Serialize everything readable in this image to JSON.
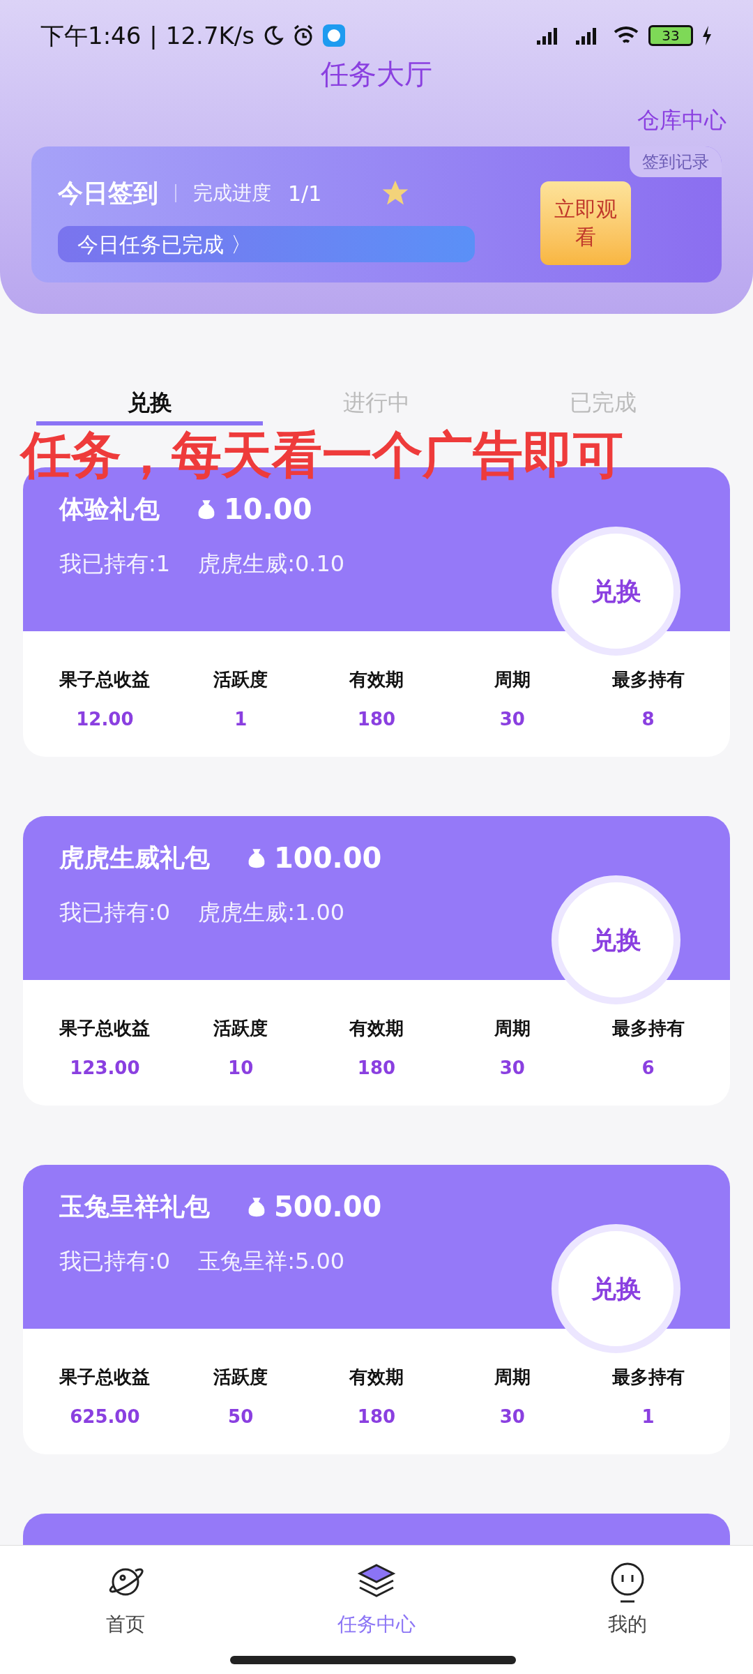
{
  "status_bar": {
    "time": "下午1:46",
    "separator": "|",
    "speed": "12.7K/s",
    "battery": "33"
  },
  "header": {
    "title": "任务大厅",
    "link": "仓库中心"
  },
  "checkin": {
    "title": "今日签到",
    "progress_label": "完成进度",
    "progress": "1/1",
    "status": "今日任务已完成",
    "status_arrow": "〉",
    "record": "签到记录",
    "sticker": "立即观看"
  },
  "tabs": [
    {
      "label": "兑换",
      "selected": true
    },
    {
      "label": "进行中",
      "selected": false
    },
    {
      "label": "已完成",
      "selected": false
    }
  ],
  "packs": [
    {
      "name": "体验礼包",
      "price": "10.00",
      "owned": "我已持有:1",
      "reward": "虎虎生威:0.10",
      "button": "兑换",
      "stats": [
        {
          "label": "果子总收益",
          "value": "12.00"
        },
        {
          "label": "活跃度",
          "value": "1"
        },
        {
          "label": "有效期",
          "value": "180"
        },
        {
          "label": "周期",
          "value": "30"
        },
        {
          "label": "最多持有",
          "value": "8"
        }
      ]
    },
    {
      "name": "虎虎生威礼包",
      "price": "100.00",
      "owned": "我已持有:0",
      "reward": "虎虎生威:1.00",
      "button": "兑换",
      "stats": [
        {
          "label": "果子总收益",
          "value": "123.00"
        },
        {
          "label": "活跃度",
          "value": "10"
        },
        {
          "label": "有效期",
          "value": "180"
        },
        {
          "label": "周期",
          "value": "30"
        },
        {
          "label": "最多持有",
          "value": "6"
        }
      ]
    },
    {
      "name": "玉兔呈祥礼包",
      "price": "500.00",
      "owned": "我已持有:0",
      "reward": "玉兔呈祥:5.00",
      "button": "兑换",
      "stats": [
        {
          "label": "果子总收益",
          "value": "625.00"
        },
        {
          "label": "活跃度",
          "value": "50"
        },
        {
          "label": "有效期",
          "value": "180"
        },
        {
          "label": "周期",
          "value": "30"
        },
        {
          "label": "最多持有",
          "value": "1"
        }
      ]
    }
  ],
  "nav": [
    {
      "label": "首页",
      "kind": "planet",
      "selected": false
    },
    {
      "label": "任务中心",
      "kind": "layers",
      "selected": true
    },
    {
      "label": "我的",
      "kind": "face",
      "selected": false
    }
  ],
  "annotation": {
    "text": "任务，每天看一个广告即可"
  }
}
